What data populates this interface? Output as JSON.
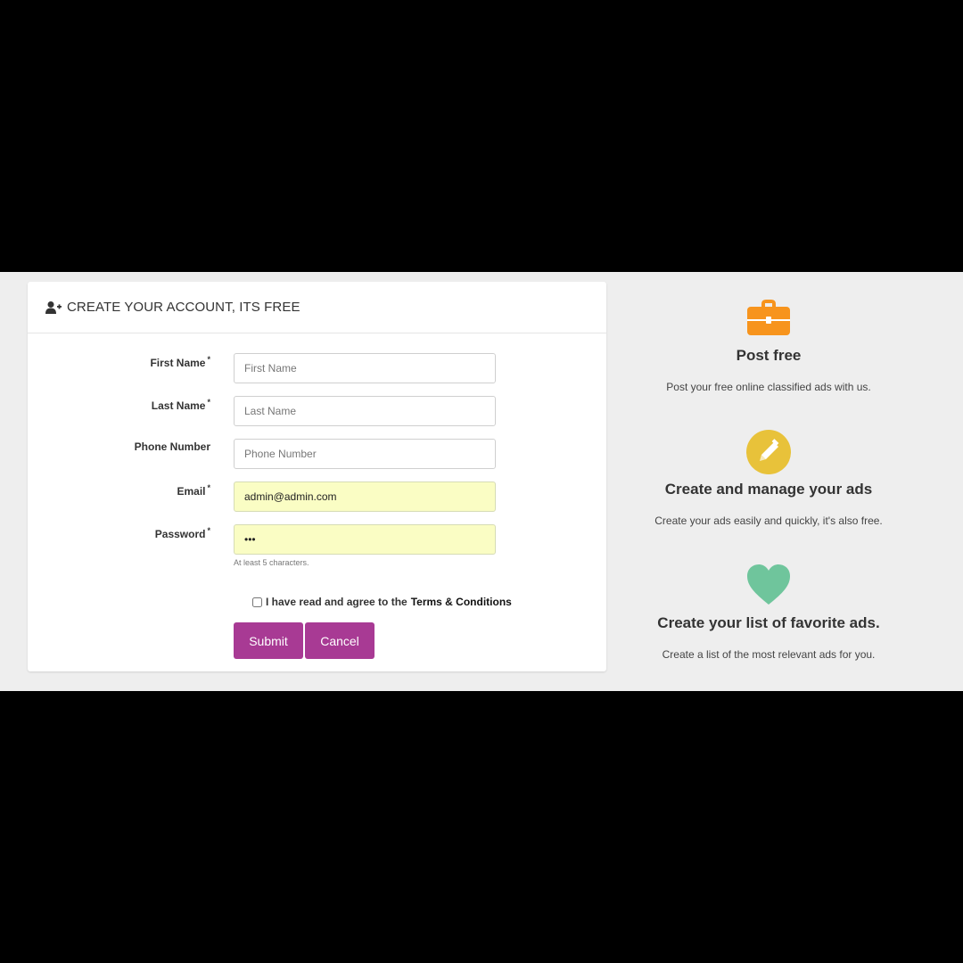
{
  "header": {
    "title": "CREATE YOUR ACCOUNT, ITS FREE",
    "icon": "user-plus-icon"
  },
  "form": {
    "first_name": {
      "label": "First Name",
      "required": "*",
      "placeholder": "First Name",
      "value": ""
    },
    "last_name": {
      "label": "Last Name",
      "required": "*",
      "placeholder": "Last Name",
      "value": ""
    },
    "phone": {
      "label": "Phone Number",
      "placeholder": "Phone Number",
      "value": ""
    },
    "email": {
      "label": "Email",
      "required": "*",
      "placeholder": "",
      "value": "admin@admin.com"
    },
    "password": {
      "label": "Password",
      "required": "*",
      "value": "•••",
      "hint": "At least 5 characters."
    },
    "agree_text": "I have read and agree to the",
    "terms_text": "Terms & Conditions",
    "submit_label": "Submit",
    "cancel_label": "Cancel"
  },
  "features": [
    {
      "icon": "briefcase-icon",
      "color": "#f7941d",
      "title": "Post free",
      "desc": "Post your free online classified ads with us."
    },
    {
      "icon": "pencil-icon",
      "color": "#e8c23a",
      "title": "Create and manage your ads",
      "desc": "Create your ads easily and quickly, it's also free."
    },
    {
      "icon": "heart-icon",
      "color": "#6fc59c",
      "title": "Create your list of favorite ads.",
      "desc": "Create a list of the most relevant ads for you."
    }
  ],
  "colors": {
    "button": "#a83a94",
    "autofill": "#fafdc4",
    "background": "#eeeeee"
  }
}
